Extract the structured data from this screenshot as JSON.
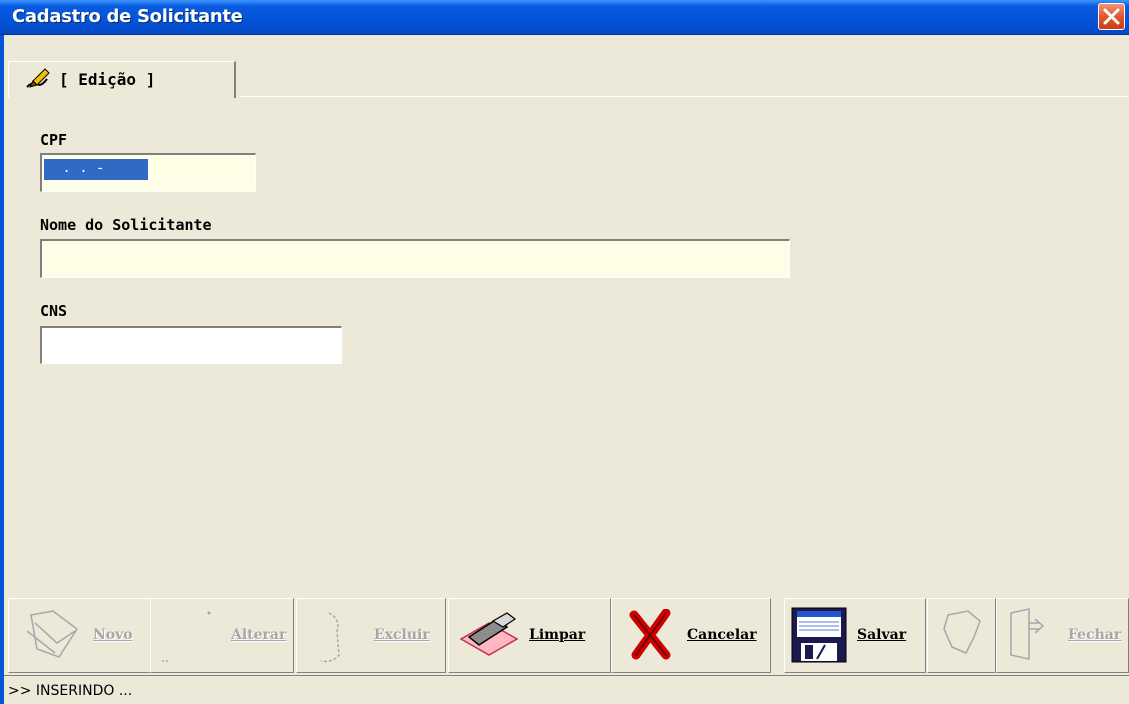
{
  "window": {
    "title": "Cadastro de Solicitante"
  },
  "tabs": [
    {
      "label": "[ Edição ]",
      "icon": "pen-icon",
      "active": true
    }
  ],
  "form": {
    "cpf": {
      "label": "CPF",
      "mask": " . . -"
    },
    "nome": {
      "label": "Nome do Solicitante",
      "value": ""
    },
    "cns": {
      "label": "CNS",
      "value": ""
    }
  },
  "toolbar": {
    "novo": {
      "label": "Novo",
      "enabled": false
    },
    "alterar": {
      "label": "Alterar",
      "enabled": false
    },
    "excluir": {
      "label": "Excluir",
      "enabled": false
    },
    "limpar": {
      "label": "Limpar",
      "enabled": true
    },
    "cancelar": {
      "label": "Cancelar",
      "enabled": true
    },
    "salvar": {
      "label": "Salvar",
      "enabled": true
    },
    "pesquisar": {
      "label": "",
      "enabled": false
    },
    "fechar": {
      "label": "Fechar",
      "enabled": false
    }
  },
  "status": {
    "text": ">> INSERINDO ..."
  },
  "colors": {
    "titlebar": "#0454D8",
    "field_bg": "#FEFEE6",
    "selection": "#316AC5",
    "face": "#ECE9D8"
  }
}
